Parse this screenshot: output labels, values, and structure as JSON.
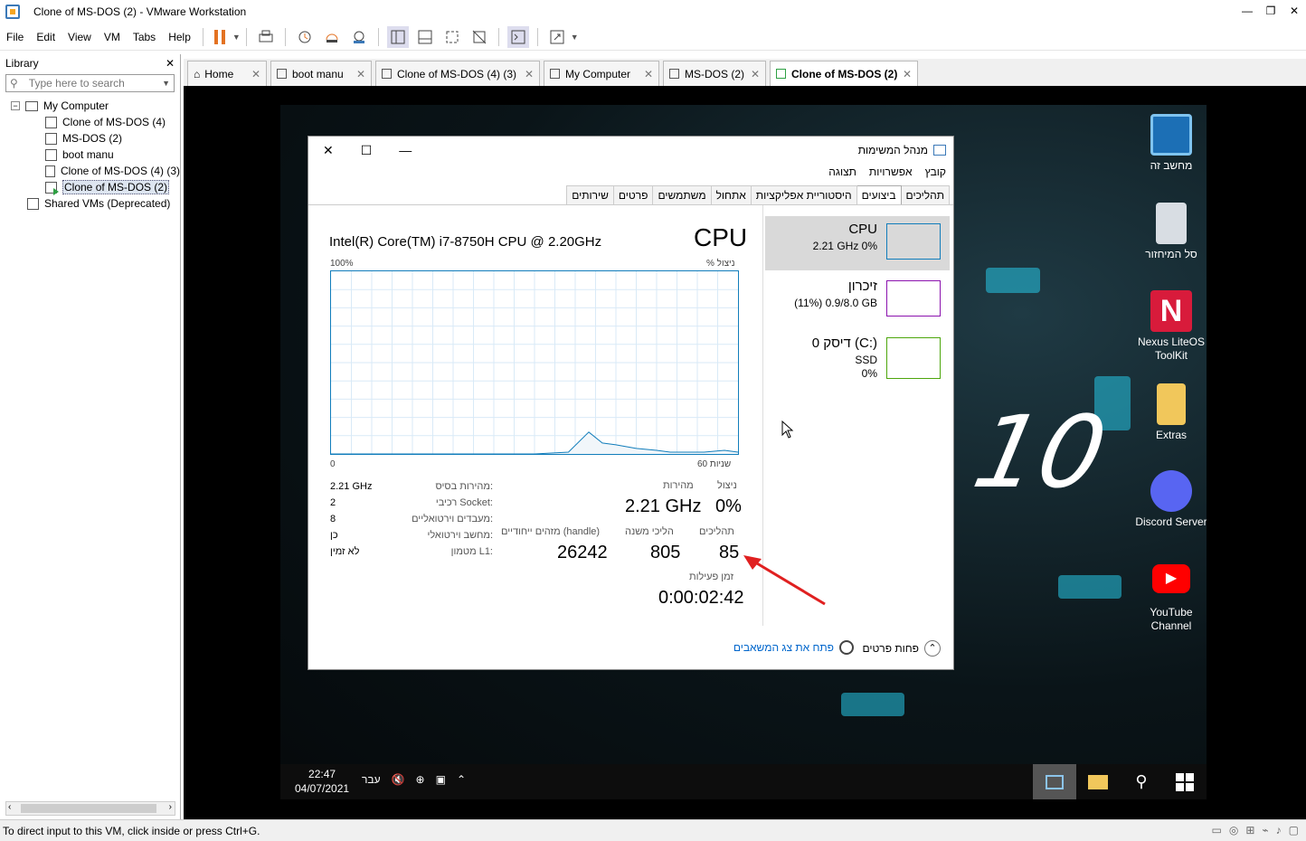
{
  "window": {
    "title": "Clone of MS-DOS (2) - VMware Workstation",
    "minimize": "—",
    "maximize": "❐",
    "close": "✕"
  },
  "menu": [
    "File",
    "Edit",
    "View",
    "VM",
    "Tabs",
    "Help"
  ],
  "library": {
    "title": "Library",
    "close": "✕",
    "search_placeholder": "Type here to search",
    "tree": {
      "root": "My Computer",
      "vms": [
        "Clone of MS-DOS (4)",
        "MS-DOS (2)",
        "boot manu",
        "Clone of MS-DOS (4) (3)",
        "Clone of MS-DOS (2)"
      ],
      "shared": "Shared VMs (Deprecated)"
    }
  },
  "tabs": [
    {
      "label": "Home"
    },
    {
      "label": "boot manu"
    },
    {
      "label": "Clone of MS-DOS (4) (3)"
    },
    {
      "label": "My Computer"
    },
    {
      "label": "MS-DOS (2)"
    },
    {
      "label": "Clone of MS-DOS (2)"
    }
  ],
  "desktop": {
    "icons": [
      {
        "label": "מחשב זה"
      },
      {
        "label": "סל המיחזור"
      },
      {
        "label": "Nexus LiteOS ToolKit"
      },
      {
        "label": "Extras"
      },
      {
        "label": "Discord Server"
      },
      {
        "label": "YouTube Channel"
      }
    ],
    "wallpaper_text": "10"
  },
  "taskbar": {
    "time": "22:47",
    "date": "04/07/2021",
    "lang": "עבר"
  },
  "taskmgr": {
    "title": "מנהל המשימות",
    "menu": [
      "קובץ",
      "אפשרויות",
      "תצוגה"
    ],
    "tabs": [
      "תהליכים",
      "ביצועים",
      "היסטוריית אפליקציות",
      "אתחול",
      "משתמשים",
      "פרטים",
      "שירותים"
    ],
    "side": {
      "cpu": {
        "name": "CPU",
        "sub": "2.21 GHz  0%"
      },
      "mem": {
        "name": "זיכרון",
        "sub": "(11%) 0.9/8.0 GB"
      },
      "disk": {
        "name": "דיסק 0 (C:)",
        "sub1": "SSD",
        "sub2": "0%"
      }
    },
    "cpu_title": "CPU",
    "cpu_model": "Intel(R) Core(TM) i7-8750H CPU @ 2.20GHz",
    "graph": {
      "left_label": "100%",
      "right_label": "% ניצול",
      "bottom_left": "0",
      "bottom_right": "60 שניות"
    },
    "stats": {
      "util_label": "ניצול",
      "util": "0%",
      "speed_label": "מהירות",
      "speed": "2.21 GHz",
      "proc_label": "תהליכים",
      "proc": "85",
      "threads_label": "הליכי משנה",
      "threads": "805",
      "handles_label": "מזהים ייחודיים (handle)",
      "handles": "26242",
      "uptime_label": "זמן פעילות",
      "uptime": "0:00:02:42"
    },
    "specs": [
      {
        "k": "מהירות בסיס:",
        "v": "2.21 GHz"
      },
      {
        "k": "רכיבי Socket:",
        "v": "2"
      },
      {
        "k": "מעבדים וירטואליים:",
        "v": "8"
      },
      {
        "k": "מחשב וירטואלי:",
        "v": "כן"
      },
      {
        "k": "מטמון L1:",
        "v": "לא זמין"
      }
    ],
    "footer": {
      "fewer": "פחות פרטים",
      "open_monitor": "פתח את צג המשאבים"
    }
  },
  "statusbar": "To direct input to this VM, click inside or press Ctrl+G.",
  "chart_data": {
    "type": "line",
    "title": "",
    "xlabel": "60 שניות",
    "ylabel": "% ניצול",
    "ylim": [
      0,
      100
    ],
    "x": [
      0,
      5,
      10,
      15,
      20,
      25,
      30,
      35,
      38,
      40,
      42,
      45,
      48,
      50,
      52,
      55,
      58,
      60
    ],
    "series": [
      {
        "values": [
          0,
          0,
          0,
          0,
          0,
          0,
          0,
          1,
          12,
          6,
          5,
          3,
          2,
          1,
          1,
          1,
          2,
          1
        ]
      }
    ]
  },
  "colors": {
    "cpu_line": "#117dbb",
    "mem": "#8b12ae",
    "disk": "#4da60c",
    "arrow": "#e02020"
  }
}
